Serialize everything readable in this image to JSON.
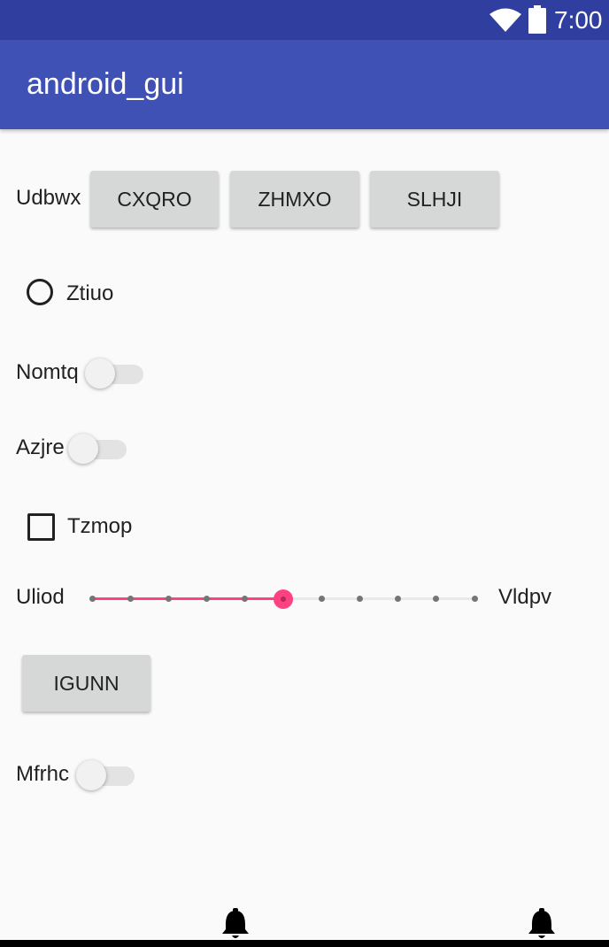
{
  "status_bar": {
    "time": "7:00",
    "wifi_icon": "wifi-icon",
    "battery_icon": "battery-icon"
  },
  "app_bar": {
    "title": "android_gui"
  },
  "row1": {
    "label": "Udbwx",
    "buttons": [
      "CXQRO",
      "ZHMXO",
      "SLHJI"
    ]
  },
  "radio": {
    "label": "Ztiuo",
    "checked": false
  },
  "switch1": {
    "label": "Nomtq",
    "on": false
  },
  "switch2": {
    "label": "Azjre",
    "on": false
  },
  "checkbox": {
    "label": "Tzmop",
    "checked": false
  },
  "slider": {
    "left_label": "Uliod",
    "right_label": "Vldpv",
    "min": 0,
    "max": 10,
    "value": 5,
    "accent_color": "#ff4081"
  },
  "button_igunn": {
    "label": "IGUNN"
  },
  "switch3": {
    "label": "Mfrhc",
    "on": false
  },
  "nav_bar": {
    "icons": [
      "bell-icon",
      "bell-icon"
    ]
  },
  "colors": {
    "status_bar": "#303f9f",
    "app_bar": "#3f51b5",
    "accent": "#ff4081"
  }
}
